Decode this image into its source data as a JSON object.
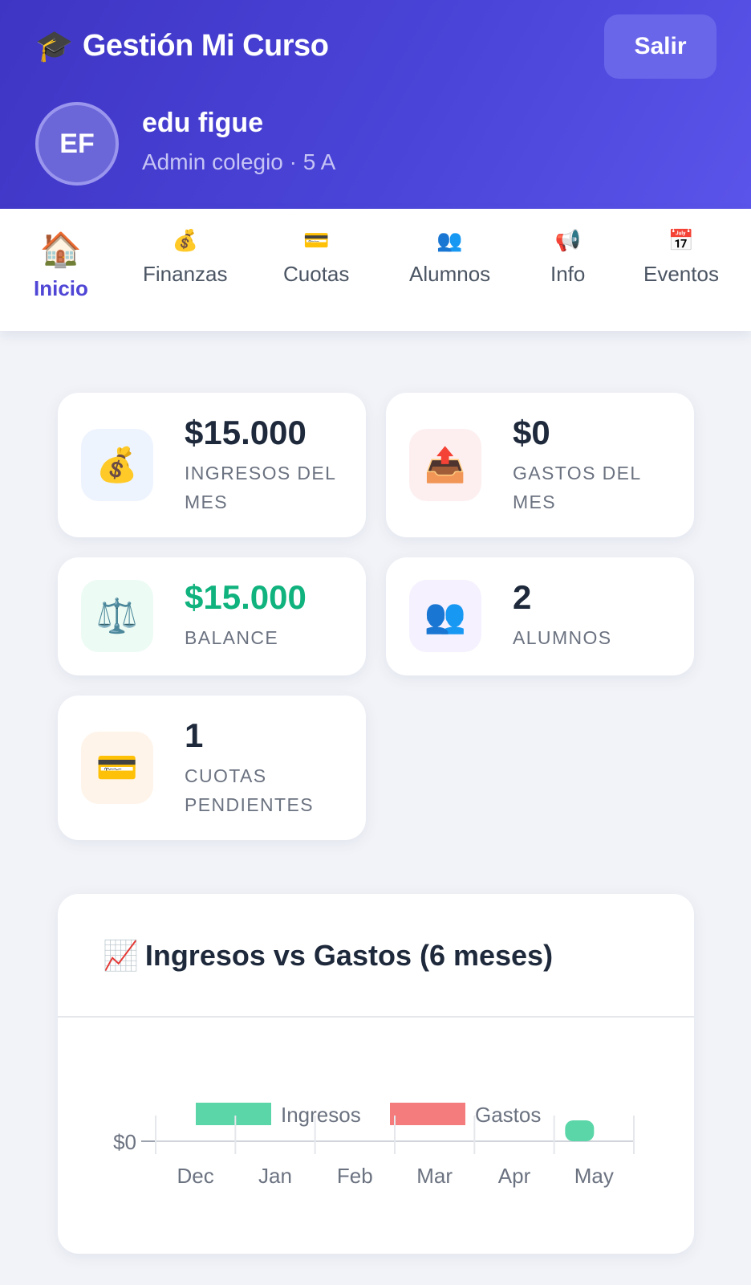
{
  "header": {
    "title": "Gestión Mi Curso",
    "title_icon": "graduation-cap-icon",
    "logout_label": "Salir",
    "avatar_initials": "EF",
    "user_name": "edu figue",
    "user_role": "Admin colegio · 5 A"
  },
  "tabs": [
    {
      "label": "Inicio",
      "icon": "🏠",
      "active": true
    },
    {
      "label": "Finanzas",
      "icon": "💰",
      "active": false
    },
    {
      "label": "Cuotas",
      "icon": "💳",
      "active": false
    },
    {
      "label": "Alumnos",
      "icon": "👥",
      "active": false
    },
    {
      "label": "Info",
      "icon": "📢",
      "active": false
    },
    {
      "label": "Eventos",
      "icon": "📅",
      "active": false
    }
  ],
  "stats": [
    {
      "value": "$15.000",
      "label": "INGRESOS DEL MES",
      "icon": "💰",
      "icon_name": "money-bag-icon",
      "bg": "#eef4fe",
      "value_color": "#1e293b"
    },
    {
      "value": "$0",
      "label": "GASTOS DEL MES",
      "icon": "📤",
      "icon_name": "outbox-tray-icon",
      "bg": "#fdeff0",
      "value_color": "#1e293b"
    },
    {
      "value": "$15.000",
      "label": "BALANCE",
      "icon": "⚖️",
      "icon_name": "balance-scale-icon",
      "bg": "#ecfbf3",
      "value_color": "#10b27d"
    },
    {
      "value": "2",
      "label": "ALUMNOS",
      "icon": "👥",
      "icon_name": "users-icon",
      "bg": "#f5f1fe",
      "value_color": "#1e293b"
    },
    {
      "value": "1",
      "label": "CUOTAS PENDIENTES",
      "icon": "💳",
      "icon_name": "credit-card-icon",
      "bg": "#fef4ea",
      "value_color": "#1e293b"
    }
  ],
  "chart_card": {
    "title": "Ingresos vs Gastos (6 meses)",
    "title_icon": "📈"
  },
  "chart_data": {
    "type": "bar",
    "title": "Ingresos vs Gastos (6 meses)",
    "categories": [
      "Dec",
      "Jan",
      "Feb",
      "Mar",
      "Apr",
      "May"
    ],
    "series": [
      {
        "name": "Ingresos",
        "color": "#5ad6a8",
        "values": [
          0,
          0,
          0,
          0,
          0,
          15000
        ]
      },
      {
        "name": "Gastos",
        "color": "#f47c7c",
        "values": [
          0,
          0,
          0,
          0,
          0,
          0
        ]
      }
    ],
    "y_tick_labels": [
      "$0"
    ],
    "legend_position": "top",
    "grid": true
  }
}
